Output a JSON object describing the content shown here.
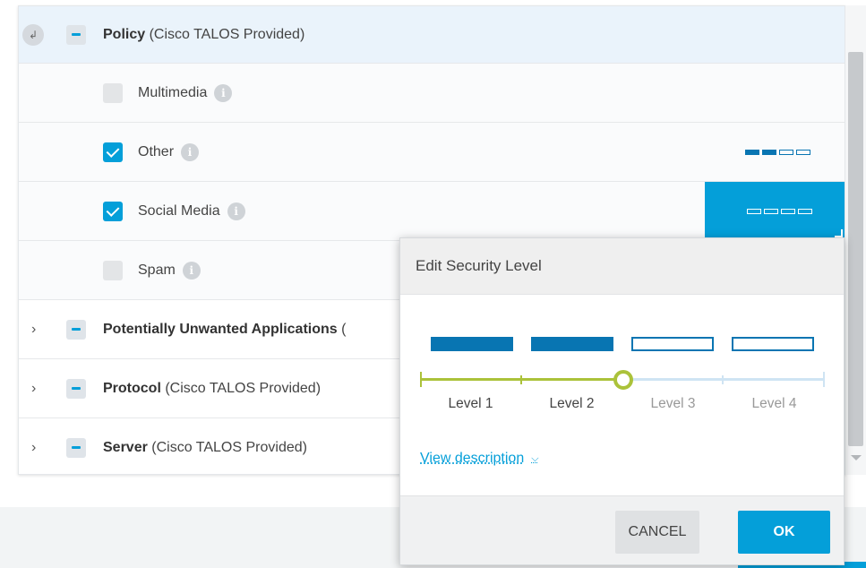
{
  "tree": {
    "policy": {
      "name": "Policy",
      "source": "(Cisco TALOS Provided)"
    },
    "categories": [
      {
        "label": "Multimedia",
        "checked": false
      },
      {
        "label": "Other",
        "checked": true,
        "level": 2
      },
      {
        "label": "Social Media",
        "checked": true,
        "level": 1
      },
      {
        "label": "Spam",
        "checked": false
      }
    ],
    "groups": [
      {
        "name": "Potentially Unwanted Applications",
        "source": "("
      },
      {
        "name": "Protocol",
        "source": "(Cisco TALOS Provided)"
      },
      {
        "name": "Server",
        "source": "(Cisco TALOS Provided)"
      }
    ]
  },
  "popover": {
    "title": "Edit Security Level",
    "selected_level": 2,
    "levels": [
      "Level 1",
      "Level 2",
      "Level 3",
      "Level 4"
    ],
    "view_description": "View description",
    "cancel_label": "CANCEL",
    "ok_label": "OK"
  },
  "icons": {
    "collapse": "collapse-corner-icon",
    "expand": "chevron-right-icon",
    "info": "info-icon",
    "dropdown": "chevron-down-icon"
  },
  "colors": {
    "accent": "#049fd9",
    "level_fill": "#0875b2",
    "slider_active": "#abc23a",
    "slider_inactive": "#cfe4f3"
  }
}
